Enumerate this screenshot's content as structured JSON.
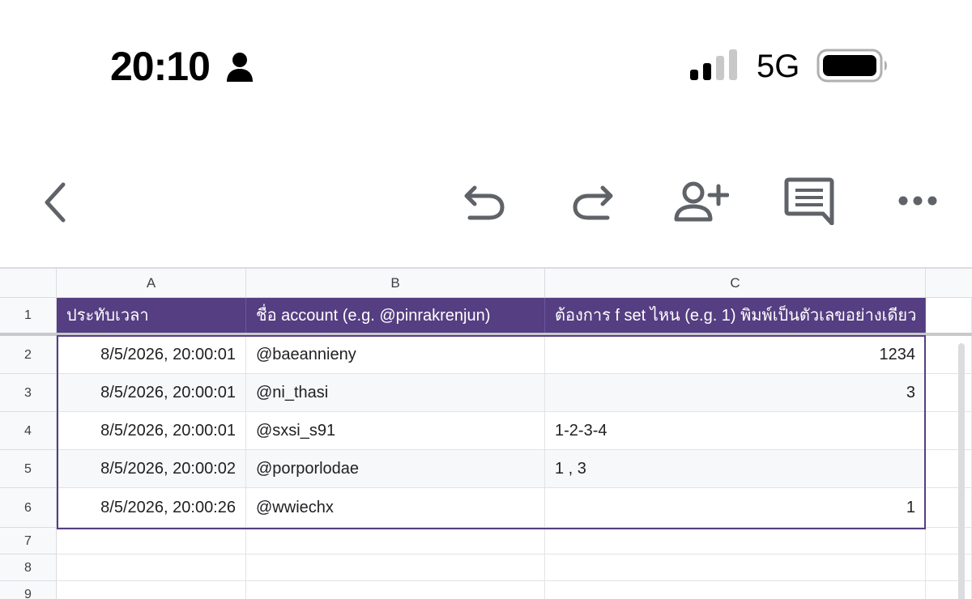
{
  "status_bar": {
    "time": "20:10",
    "network": "5G"
  },
  "toolbar": {
    "icons": [
      "back-icon",
      "undo-icon",
      "redo-icon",
      "add-person-icon",
      "comment-icon",
      "more-icon"
    ]
  },
  "sheet": {
    "column_headers": [
      "A",
      "B",
      "C"
    ],
    "row_numbers": [
      "1",
      "2",
      "3",
      "4",
      "5",
      "6",
      "7",
      "8",
      "9"
    ],
    "header_row": {
      "a": "ประทับเวลา",
      "b": "ชื่อ account (e.g. @pinrakrenjun)",
      "c": "ต้องการ f set ไหน (e.g. 1) พิมพ์เป็นตัวเลขอย่างเดียว"
    },
    "rows": [
      {
        "timestamp": "8/5/2026, 20:00:01",
        "account": "@baeannieny",
        "set": "1234"
      },
      {
        "timestamp": "8/5/2026, 20:00:01",
        "account": "@ni_thasi",
        "set": "3"
      },
      {
        "timestamp": "8/5/2026, 20:00:01",
        "account": "@sxsi_s91",
        "set": "1-2-3-4"
      },
      {
        "timestamp": "8/5/2026, 20:00:02",
        "account": "@porporlodae",
        "set": "1 , 3"
      },
      {
        "timestamp": "8/5/2026, 20:00:26",
        "account": "@wwiechx",
        "set": "1"
      }
    ]
  },
  "colors": {
    "header_fill": "#553e81",
    "header_text": "#ffffff",
    "alt_row": "#f6f8f9"
  }
}
